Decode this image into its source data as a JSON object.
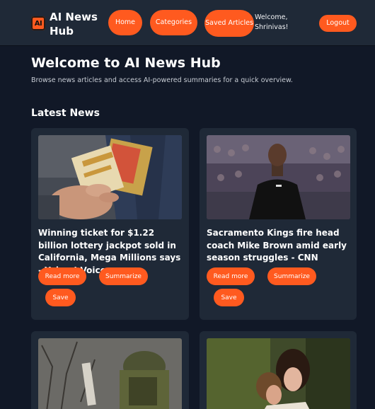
{
  "header": {
    "logo_text": "AI",
    "brand": "AI News Hub",
    "nav": {
      "home": "Home",
      "categories": "Categories",
      "saved": "Saved Articles"
    },
    "welcome": "Welcome, Shrinivas!",
    "logout": "Logout"
  },
  "main": {
    "title": "Welcome to AI News Hub",
    "subtitle": "Browse news articles and access AI-powered summaries for a quick overview.",
    "section_title": "Latest News"
  },
  "articles": [
    {
      "title": "Winning ticket for $1.22 billion lottery jackpot sold in California, Mega Millions says - Yahoo! Voices",
      "read_more": "Read more",
      "summarize": "Summarize",
      "save": "Save"
    },
    {
      "title": "Sacramento Kings fire head coach Mike Brown amid early season struggles - CNN",
      "read_more": "Read more",
      "summarize": "Summarize",
      "save": "Save"
    },
    {
      "title": ""
    },
    {
      "title": ""
    }
  ],
  "colors": {
    "accent": "#ff5a1f",
    "background": "#111827",
    "card": "#1f2937"
  }
}
